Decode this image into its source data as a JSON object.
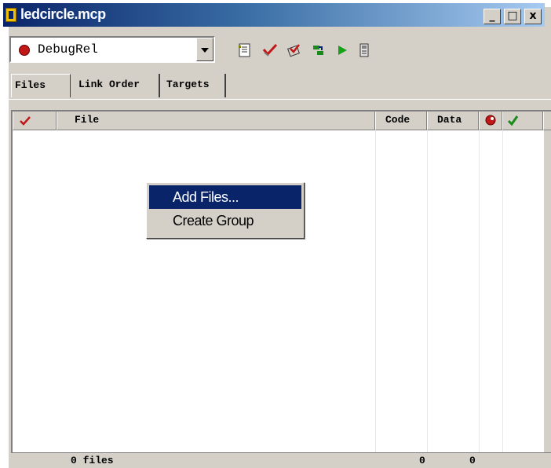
{
  "window": {
    "title": "ledcircle.mcp",
    "controls": {
      "minimize": "_",
      "maximize": "□",
      "close": "x"
    }
  },
  "toolbar": {
    "target_select": {
      "value": "DebugRel",
      "icon": "debug-target-icon"
    },
    "tools": [
      {
        "name": "settings-icon"
      },
      {
        "name": "check-syntax-icon"
      },
      {
        "name": "compile-icon"
      },
      {
        "name": "make-icon"
      },
      {
        "name": "run-icon"
      },
      {
        "name": "debug-icon"
      }
    ]
  },
  "tabs": [
    {
      "label": "Files",
      "active": true
    },
    {
      "label": "Link Order",
      "active": false
    },
    {
      "label": "Targets",
      "active": false
    }
  ],
  "file_list": {
    "columns": {
      "check": "check-icon",
      "file": "File",
      "code": "Code",
      "data": "Data",
      "debug": "debug-icon",
      "touch": "touch-icon"
    },
    "rows": []
  },
  "status_bar": {
    "files": "0 files",
    "code_total": "0",
    "data_total": "0"
  },
  "context_menu": {
    "items": [
      {
        "label": "Add Files...",
        "highlighted": true
      },
      {
        "label": "Create Group",
        "highlighted": false
      }
    ]
  },
  "colors": {
    "title_bar": "#0a246a",
    "menu_highlight": "#0a246a",
    "window_face": "#d4d0c8"
  }
}
